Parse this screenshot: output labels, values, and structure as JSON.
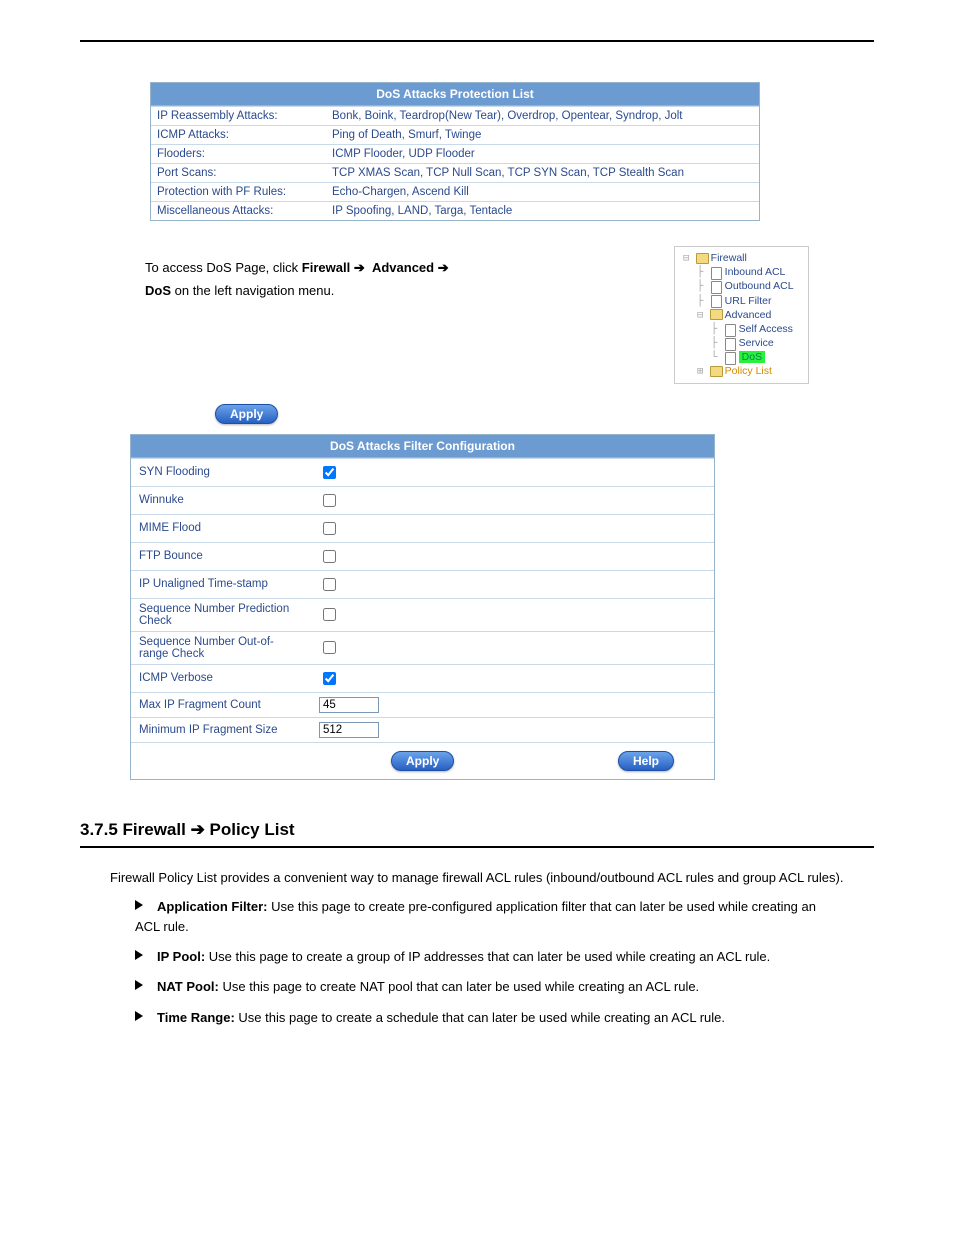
{
  "protection": {
    "header": "DoS Attacks Protection List",
    "rows": [
      {
        "label": "IP Reassembly Attacks:",
        "value": "Bonk, Boink, Teardrop(New Tear), Overdrop, Opentear, Syndrop, Jolt"
      },
      {
        "label": "ICMP Attacks:",
        "value": "Ping of Death, Smurf, Twinge"
      },
      {
        "label": "Flooders:",
        "value": "ICMP Flooder, UDP Flooder"
      },
      {
        "label": "Port Scans:",
        "value": "TCP XMAS Scan, TCP Null Scan, TCP SYN Scan, TCP Stealth Scan"
      },
      {
        "label": "Protection with PF Rules:",
        "value": "Echo-Chargen, Ascend Kill"
      },
      {
        "label": "Miscellaneous Attacks:",
        "value": "IP Spoofing, LAND, Targa, Tentacle"
      }
    ]
  },
  "nav_text": {
    "p1a": "To access DoS Page, click ",
    "p1b": "Firewall ",
    "p1c": "Advanced ",
    "p1d": "DoS",
    "p1e": " on the left navigation menu."
  },
  "tree": {
    "firewall": "Firewall",
    "inbound": "Inbound ACL",
    "outbound": "Outbound ACL",
    "urlfilter": "URL Filter",
    "advanced": "Advanced",
    "selfaccess": "Self Access",
    "service": "Service",
    "dos": "DoS",
    "policy": "Policy List"
  },
  "apply_label": "Apply",
  "help_label": "Help",
  "config": {
    "header": "DoS Attacks Filter Configuration",
    "rows": [
      {
        "label": "SYN Flooding",
        "type": "checkbox",
        "checked": true
      },
      {
        "label": "Winnuke",
        "type": "checkbox",
        "checked": false
      },
      {
        "label": "MIME Flood",
        "type": "checkbox",
        "checked": false
      },
      {
        "label": "FTP Bounce",
        "type": "checkbox",
        "checked": false
      },
      {
        "label": "IP Unaligned Time-stamp",
        "type": "checkbox",
        "checked": false
      },
      {
        "label": "Sequence Number Prediction Check",
        "type": "checkbox",
        "checked": false
      },
      {
        "label": "Sequence Number Out-of-range Check",
        "type": "checkbox",
        "checked": false
      },
      {
        "label": "ICMP Verbose",
        "type": "checkbox",
        "checked": true
      },
      {
        "label": "Max IP Fragment Count",
        "type": "text",
        "value": "45"
      },
      {
        "label": "Minimum IP Fragment Size",
        "type": "text",
        "value": "512"
      }
    ]
  },
  "section": {
    "heading_prefix": "3.7.5 Firewall ",
    "heading_suffix": " Policy List",
    "intro": "Firewall Policy List provides a convenient way to manage firewall ACL rules (inbound/outbound ACL rules and group ACL rules).",
    "bullets": [
      {
        "bold": "Application Filter:",
        "text": " Use this page to create pre-configured application filter that can later be used while creating an ACL rule."
      },
      {
        "bold": "IP Pool:",
        "text": " Use this page to create a group of IP addresses that can later be used while creating an ACL rule."
      },
      {
        "bold": "NAT Pool:",
        "text": " Use this page to create NAT pool that can later be used while creating an ACL rule."
      },
      {
        "bold": "Time Range:",
        "text": " Use this page to create a schedule that can later be used while creating an ACL rule."
      }
    ]
  }
}
